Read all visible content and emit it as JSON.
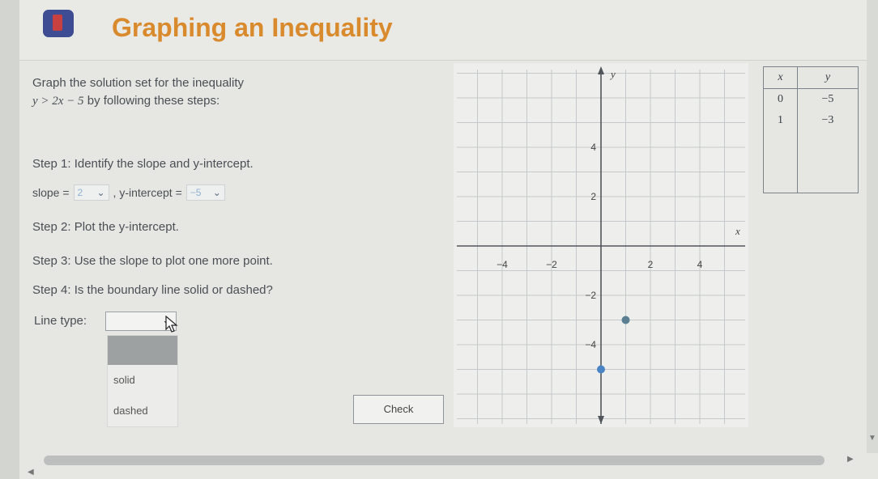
{
  "header": {
    "title": "Graphing an Inequality"
  },
  "instructions": {
    "line1": "Graph the solution set for the inequality",
    "line2_math": "y > 2x − 5",
    "line2_rest": " by following these steps:"
  },
  "steps": {
    "step1": "Step 1: Identify the slope and y-intercept.",
    "slope_label": "slope =",
    "slope_value": "2",
    "intercept_label": ", y-intercept =",
    "intercept_value": "−5",
    "step2": "Step 2: Plot the y-intercept.",
    "step3": "Step 3: Use the slope to plot one more point.",
    "step4": "Step 4: Is the boundary line solid or dashed?",
    "line_type_label": "Line type:",
    "line_type_options": [
      "solid",
      "dashed"
    ]
  },
  "check_button": "Check",
  "graph": {
    "x_label": "x",
    "y_label": "y",
    "x_ticks": [
      "−4",
      "−2",
      "2",
      "4"
    ],
    "y_ticks": [
      "4",
      "2",
      "−2",
      "−4"
    ],
    "points": [
      {
        "x": 0,
        "y": -5,
        "color": "#4a84c4"
      },
      {
        "x": 1,
        "y": -3,
        "color": "#5a7e92"
      }
    ]
  },
  "table": {
    "headers": [
      "x",
      "y"
    ],
    "rows": [
      [
        "0",
        "−5"
      ],
      [
        "1",
        "−3"
      ]
    ]
  },
  "icons": {
    "dropdown": "chevron-down-icon",
    "cursor": "pointer-cursor-icon",
    "scroll_left": "arrow-left-icon",
    "scroll_right": "arrow-right-icon",
    "scroll_down": "arrow-down-icon"
  }
}
